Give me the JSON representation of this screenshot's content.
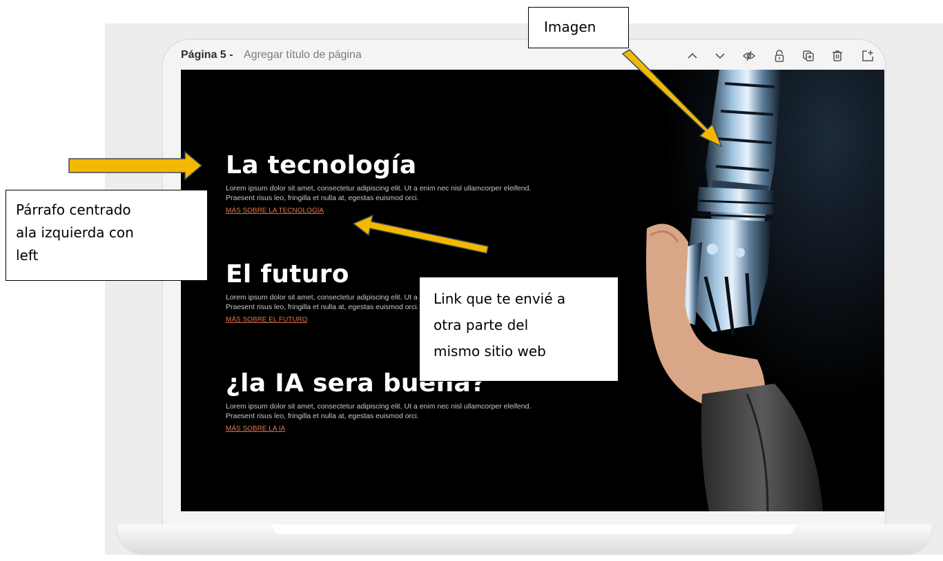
{
  "page_header": {
    "page_number": "Página 5 -",
    "title_placeholder": "Agregar título de página"
  },
  "toolbar": {
    "icons": [
      "chevron-up-icon",
      "chevron-down-icon",
      "hide-icon",
      "lock-icon",
      "duplicate-icon",
      "trash-icon",
      "add-page-icon"
    ]
  },
  "sections": [
    {
      "heading": "La tecnología",
      "paragraph": "Lorem ipsum dolor sit amet, consectetur adipiscing elit. Ut a enim nec nisl ullamcorper eleifend. Praesent risus leo, fringilla et nulla at, egestas euismod orci.",
      "link": "MÁS SOBRE LA TECNOLOGÍA"
    },
    {
      "heading": "El futuro",
      "paragraph": "Lorem ipsum dolor sit amet, consectetur adipiscing elit. Ut a enim nec nisl ullamcorper eleifend. Praesent risus leo, fringilla et nulla at, egestas euismod orci.",
      "link": "MÁS SOBRE EL FUTURO"
    },
    {
      "heading": "¿la IA sera buena?",
      "paragraph": "Lorem ipsum dolor sit amet, consectetur adipiscing elit. Ut a enim nec nisl ullamcorper eleifend. Praesent risus leo, fringilla et nulla at, egestas euismod orci.",
      "link": "MÁS SOBRE LA IA"
    }
  ],
  "callouts": {
    "imagen": "Imagen",
    "parrafo": "Párrafo centrado\nala izquierda con\nleft",
    "link": "Link que te envié a\notra parte del\nmismo sitio web"
  },
  "colors": {
    "link": "#e0764b",
    "arrow_fill": "#f5b800",
    "arrow_stroke": "#3a4a5a",
    "screen_bg": "#000000"
  }
}
